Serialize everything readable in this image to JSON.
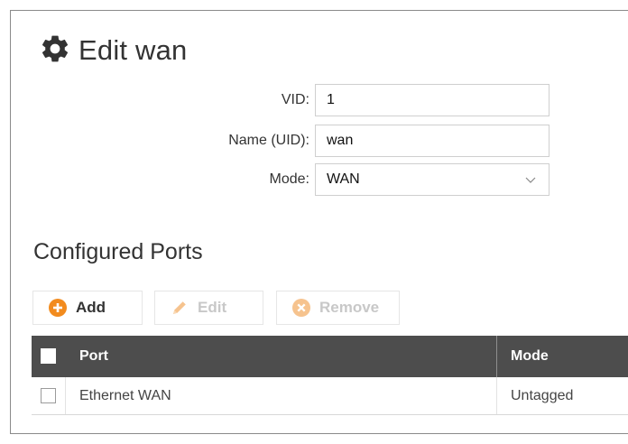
{
  "page": {
    "title": "Edit wan",
    "title_icon": "gear-icon"
  },
  "form": {
    "vid": {
      "label": "VID:",
      "value": "1"
    },
    "name": {
      "label": "Name (UID):",
      "value": "wan"
    },
    "mode": {
      "label": "Mode:",
      "value": "WAN"
    }
  },
  "ports": {
    "section_title": "Configured Ports",
    "toolbar": {
      "add_label": "Add",
      "edit_label": "Edit",
      "remove_label": "Remove"
    },
    "columns": {
      "port": "Port",
      "mode": "Mode"
    },
    "rows": [
      {
        "port": "Ethernet WAN",
        "mode": "Untagged"
      }
    ]
  },
  "colors": {
    "add_accent": "#f28b1e",
    "remove_accent": "#f6c38e",
    "header_bg": "#4d4d4d"
  }
}
